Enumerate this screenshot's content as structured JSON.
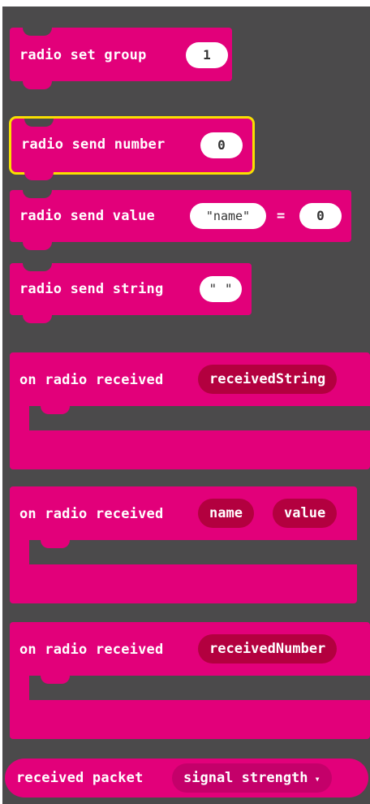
{
  "blocks": {
    "set_group": {
      "label": "radio set group",
      "value": "1"
    },
    "send_number": {
      "label": "radio send number",
      "value": "0"
    },
    "send_value": {
      "label": "radio send value",
      "name": "\"name\"",
      "equals": "=",
      "value": "0"
    },
    "send_string": {
      "label": "radio send string",
      "value": "\" \""
    },
    "received_string": {
      "label": "on radio received",
      "var": "receivedString"
    },
    "received_value": {
      "label": "on radio received",
      "var1": "name",
      "var2": "value"
    },
    "received_number": {
      "label": "on radio received",
      "var": "receivedNumber"
    },
    "received_packet": {
      "label": "received packet",
      "dropdown": "signal strength",
      "arrow": "▾"
    }
  },
  "colors": {
    "block": "#e2007a",
    "variable": "#b3003f",
    "background": "#4b4a4b",
    "highlight": "#f9df00"
  }
}
